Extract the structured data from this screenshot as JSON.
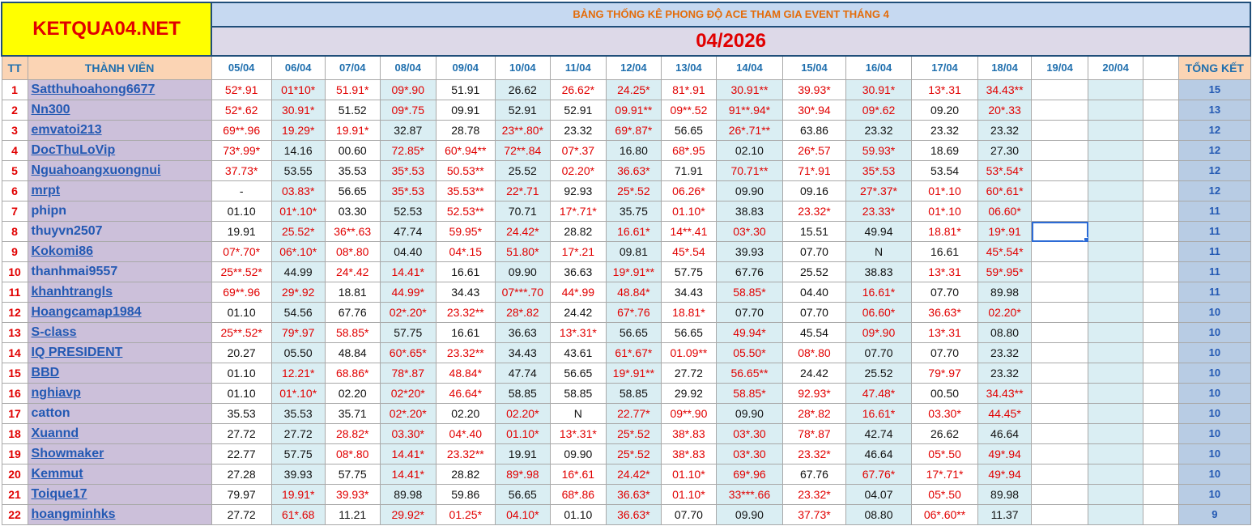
{
  "logo": "KETQUA04.NET",
  "title": "BẢNG THỐNG KÊ PHONG ĐỘ ACE THAM GIA EVENT THÁNG 4",
  "month": "04/2026",
  "headers": {
    "tt": "TT",
    "member": "THÀNH VIÊN",
    "dates": [
      "05/04",
      "06/04",
      "07/04",
      "08/04",
      "09/04",
      "10/04",
      "11/04",
      "12/04",
      "13/04",
      "14/04",
      "15/04",
      "16/04",
      "17/04",
      "18/04",
      "19/04",
      "20/04"
    ],
    "total": "TỔNG KẾT"
  },
  "colors": {
    "red": "#e10000",
    "blue": "#2359b3",
    "header_blue": "#1f6fae",
    "logo_bg": "#ffff00",
    "member_bg": "#ccc0da"
  },
  "rows": [
    {
      "tt": "1",
      "name": "Satthuhoahong6677",
      "link": true,
      "cells": [
        "52*.91",
        "01*10*",
        "51.91*",
        "09*.90",
        "51.91",
        "26.62",
        "26.62*",
        "24.25*",
        "81*.91",
        "30.91**",
        "39.93*",
        "30.91*",
        "13*.31",
        "34.43**"
      ],
      "total": "15"
    },
    {
      "tt": "2",
      "name": "Nn300",
      "link": true,
      "cells": [
        "52*.62",
        "30.91*",
        "51.52",
        "09*.75",
        "09.91",
        "52.91",
        "52.91",
        "09.91**",
        "09**.52",
        "91**.94*",
        "30*.94",
        "09*.62",
        "09.20",
        "20*.33"
      ],
      "total": "13"
    },
    {
      "tt": "3",
      "name": "emvatoi213",
      "link": true,
      "cells": [
        "69**.96",
        "19.29*",
        "19.91*",
        "32.87",
        "28.78",
        "23**.80*",
        "23.32",
        "69*.87*",
        "56.65",
        "26*.71**",
        "63.86",
        "23.32",
        "23.32",
        "23.32"
      ],
      "total": "12"
    },
    {
      "tt": "4",
      "name": "DocThuLoVip",
      "link": true,
      "cells": [
        "73*.99*",
        "14.16",
        "00.60",
        "72.85*",
        "60*.94**",
        "72**.84",
        "07*.37",
        "16.80",
        "68*.95",
        "02.10",
        "26*.57",
        "59.93*",
        "18.69",
        "27.30"
      ],
      "total": "12"
    },
    {
      "tt": "5",
      "name": "Nguahoangxuongnui",
      "link": true,
      "cells": [
        "37.73*",
        "53.55",
        "35.53",
        "35*.53",
        "50.53**",
        "25.52",
        "02.20*",
        "36.63*",
        "71.91",
        "70.71**",
        "71*.91",
        "35*.53",
        "53.54",
        "53*.54*"
      ],
      "total": "12"
    },
    {
      "tt": "6",
      "name": "mrpt",
      "link": true,
      "cells": [
        "-",
        "03.83*",
        "56.65",
        "35*.53",
        "35.53**",
        "22*.71",
        "92.93",
        "25*.52",
        "06.26*",
        "09.90",
        "09.16",
        "27*.37*",
        "01*.10",
        "60*.61*"
      ],
      "total": "12"
    },
    {
      "tt": "7",
      "name": "phipn",
      "link": false,
      "cells": [
        "01.10",
        "01*.10*",
        "03.30",
        "52.53",
        "52.53**",
        "70.71",
        "17*.71*",
        "35.75",
        "01.10*",
        "38.83",
        "23.32*",
        "23.33*",
        "01*.10",
        "06.60*"
      ],
      "total": "11"
    },
    {
      "tt": "8",
      "name": "thuyvn2507",
      "link": false,
      "cells": [
        "19.91",
        "25.52*",
        "36**.63",
        "47.74",
        "59.95*",
        "24.42*",
        "28.82",
        "16.61*",
        "14**.41",
        "03*.30",
        "15.51",
        "49.94",
        "18.81*",
        "19*.91"
      ],
      "total": "11"
    },
    {
      "tt": "9",
      "name": "Kokomi86",
      "link": true,
      "cells": [
        "07*.70*",
        "06*.10*",
        "08*.80",
        "04.40",
        "04*.15",
        "51.80*",
        "17*.21",
        "09.81",
        "45*.54",
        "39.93",
        "07.70",
        "N",
        "16.61",
        "45*.54*"
      ],
      "total": "11"
    },
    {
      "tt": "10",
      "name": "thanhmai9557",
      "link": false,
      "cells": [
        "25**.52*",
        "44.99",
        "24*.42",
        "14.41*",
        "16.61",
        "09.90",
        "36.63",
        "19*.91**",
        "57.75",
        "67.76",
        "25.52",
        "38.83",
        "13*.31",
        "59*.95*"
      ],
      "total": "11"
    },
    {
      "tt": "11",
      "name": "khanhtrangls",
      "link": true,
      "cells": [
        "69**.96",
        "29*.92",
        "18.81",
        "44.99*",
        "34.43",
        "07***.70",
        "44*.99",
        "48.84*",
        "34.43",
        "58.85*",
        "04.40",
        "16.61*",
        "07.70",
        "89.98"
      ],
      "total": "11"
    },
    {
      "tt": "12",
      "name": "Hoangcamap1984",
      "link": true,
      "cells": [
        "01.10",
        "54.56",
        "67.76",
        "02*.20*",
        "23.32**",
        "28*.82",
        "24.42",
        "67*.76",
        "18.81*",
        "07.70",
        "07.70",
        "06.60*",
        "36.63*",
        "02.20*"
      ],
      "total": "10"
    },
    {
      "tt": "13",
      "name": "S-class",
      "link": true,
      "cells": [
        "25**.52*",
        "79*.97",
        "58.85*",
        "57.75",
        "16.61",
        "36.63",
        "13*.31*",
        "56.65",
        "56.65",
        "49.94*",
        "45.54",
        "09*.90",
        "13*.31",
        "08.80"
      ],
      "total": "10"
    },
    {
      "tt": "14",
      "name": "IQ PRESIDENT",
      "link": true,
      "cells": [
        "20.27",
        "05.50",
        "48.84",
        "60*.65*",
        "23.32**",
        "34.43",
        "43.61",
        "61*.67*",
        "01.09**",
        "05.50*",
        "08*.80",
        "07.70",
        "07.70",
        "23.32"
      ],
      "total": "10"
    },
    {
      "tt": "15",
      "name": "BBD",
      "link": true,
      "cells": [
        "01.10",
        "12.21*",
        "68.86*",
        "78*.87",
        "48.84*",
        "47.74",
        "56.65",
        "19*.91**",
        "27.72",
        "56.65**",
        "24.42",
        "25.52",
        "79*.97",
        "23.32"
      ],
      "total": "10"
    },
    {
      "tt": "16",
      "name": "nghiavp",
      "link": true,
      "cells": [
        "01.10",
        "01*.10*",
        "02.20",
        "02*20*",
        "46.64*",
        "58.85",
        "58.85",
        "58.85",
        "29.92",
        "58.85*",
        "92.93*",
        "47.48*",
        "00.50",
        "34.43**"
      ],
      "total": "10"
    },
    {
      "tt": "17",
      "name": "catton",
      "link": false,
      "cells": [
        "35.53",
        "35.53",
        "35.71",
        "02*.20*",
        "02.20",
        "02.20*",
        "N",
        "22.77*",
        "09**.90",
        "09.90",
        "28*.82",
        "16.61*",
        "03.30*",
        "44.45*"
      ],
      "total": "10"
    },
    {
      "tt": "18",
      "name": "Xuannd",
      "link": true,
      "cells": [
        "27.72",
        "27.72",
        "28.82*",
        "03.30*",
        "04*.40",
        "01.10*",
        "13*.31*",
        "25*.52",
        "38*.83",
        "03*.30",
        "78*.87",
        "42.74",
        "26.62",
        "46.64"
      ],
      "total": "10"
    },
    {
      "tt": "19",
      "name": "Showmaker",
      "link": true,
      "cells": [
        "22.77",
        "57.75",
        "08*.80",
        "14.41*",
        "23.32**",
        "19.91",
        "09.90",
        "25*.52",
        "38*.83",
        "03*.30",
        "23.32*",
        "46.64",
        "05*.50",
        "49*.94"
      ],
      "total": "10"
    },
    {
      "tt": "20",
      "name": "Kemmut",
      "link": true,
      "cells": [
        "27.28",
        "39.93",
        "57.75",
        "14.41*",
        "28.82",
        "89*.98",
        "16*.61",
        "24.42*",
        "01.10*",
        "69*.96",
        "67.76",
        "67.76*",
        "17*.71*",
        "49*.94"
      ],
      "total": "10"
    },
    {
      "tt": "21",
      "name": "Toique17",
      "link": true,
      "cells": [
        "79.97",
        "19.91*",
        "39.93*",
        "89.98",
        "59.86",
        "56.65",
        "68*.86",
        "36.63*",
        "01.10*",
        "33***.66",
        "23.32*",
        "04.07",
        "05*.50",
        "89.98"
      ],
      "total": "10"
    },
    {
      "tt": "22",
      "name": "hoangminhks",
      "link": true,
      "cells": [
        "27.72",
        "61*.68",
        "11.21",
        "29.92*",
        "01.25*",
        "04.10*",
        "01.10",
        "36.63*",
        "07.70",
        "09.90",
        "37.73*",
        "08.80",
        "06*.60**",
        "11.37"
      ],
      "total": "9"
    }
  ]
}
